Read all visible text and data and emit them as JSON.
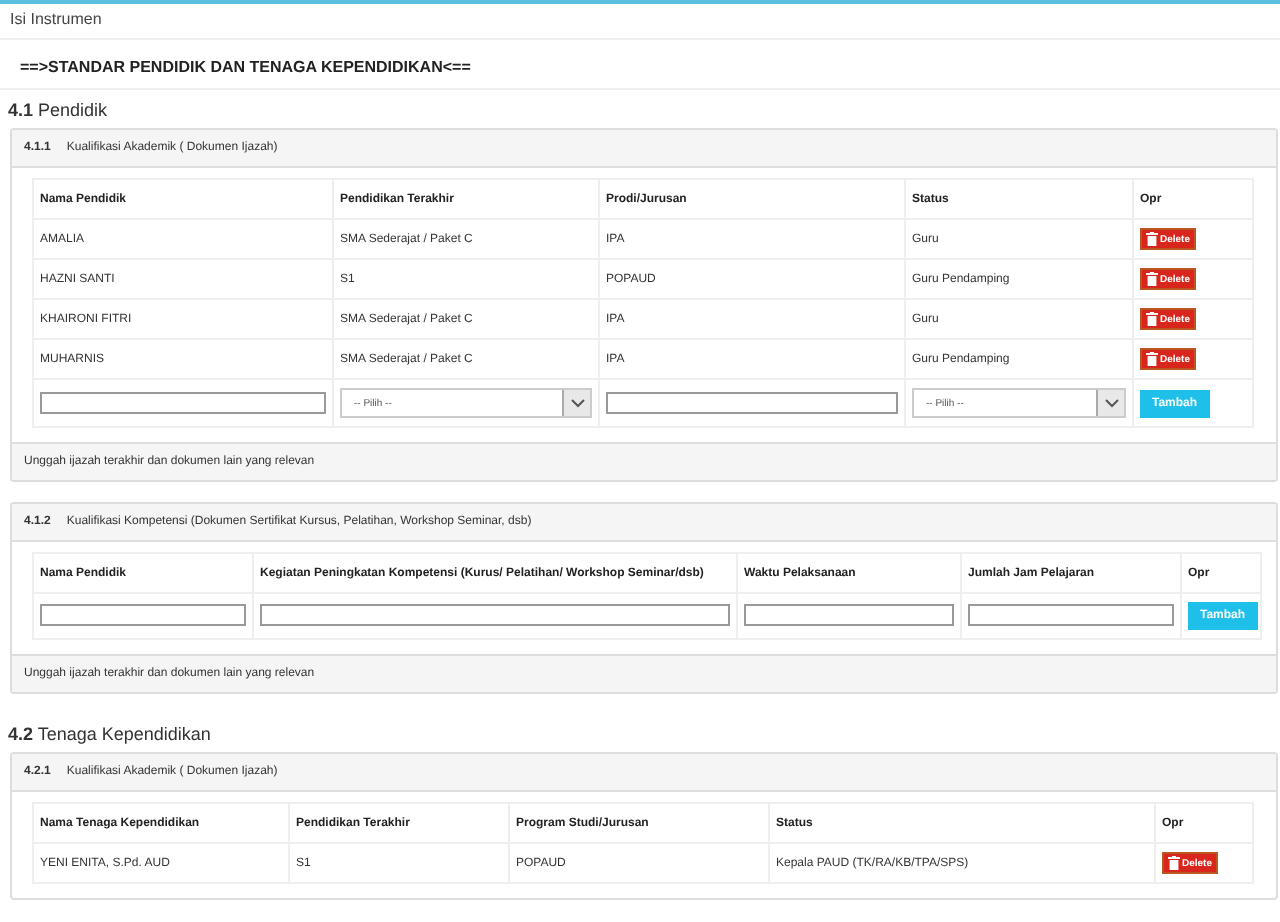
{
  "header": {
    "title": "Isi Instrumen"
  },
  "banner": "==>STANDAR PENDIDIK DAN TENAGA KEPENDIDIKAN<==",
  "sections": [
    {
      "number": "4.1",
      "title": "Pendidik",
      "panels": [
        {
          "number": "4.1.1",
          "title": "Kualifikasi Akademik ( Dokumen Ijazah)",
          "columns": [
            "Nama Pendidik",
            "Pendidikan Terakhir",
            "Prodi/Jurusan",
            "Status",
            "Opr"
          ],
          "rows": [
            {
              "cells": [
                "AMALIA",
                "SMA Sederajat / Paket C",
                "IPA",
                "Guru"
              ],
              "action": "Delete"
            },
            {
              "cells": [
                "HAZNI SANTI",
                "S1",
                "POPAUD",
                "Guru Pendamping"
              ],
              "action": "Delete"
            },
            {
              "cells": [
                "KHAIRONI FITRI",
                "SMA Sederajat / Paket C",
                "IPA",
                "Guru"
              ],
              "action": "Delete"
            },
            {
              "cells": [
                "MUHARNIS",
                "SMA Sederajat / Paket C",
                "IPA",
                "Guru Pendamping"
              ],
              "action": "Delete"
            }
          ],
          "inputs": [
            {
              "kind": "text"
            },
            {
              "kind": "select",
              "placeholder": "-- Pilih --"
            },
            {
              "kind": "text"
            },
            {
              "kind": "select",
              "placeholder": "-- Pilih --"
            }
          ],
          "button": "Tambah",
          "footer": "Unggah ijazah terakhir dan dokumen lain yang relevan"
        },
        {
          "number": "4.1.2",
          "title": "Kualifikasi Kompetensi (Dokumen Sertifikat Kursus, Pelatihan, Workshop Seminar, dsb)",
          "columns": [
            "Nama Pendidik",
            "Kegiatan Peningkatan Kompetensi (Kurus/ Pelatihan/ Workshop Seminar/dsb)",
            "Waktu Pelaksanaan",
            "Jumlah Jam Pelajaran",
            "Opr"
          ],
          "inputs": [
            {
              "kind": "text"
            },
            {
              "kind": "text"
            },
            {
              "kind": "text"
            },
            {
              "kind": "text"
            }
          ],
          "button": "Tambah",
          "footer": "Unggah ijazah terakhir dan dokumen lain yang relevan"
        }
      ]
    },
    {
      "number": "4.2",
      "title": "Tenaga Kependidikan",
      "panels": [
        {
          "number": "4.2.1",
          "title": "Kualifikasi Akademik ( Dokumen Ijazah)",
          "columns": [
            "Nama Tenaga Kependidikan",
            "Pendidikan Terakhir",
            "Program Studi/Jurusan",
            "Status",
            "Opr"
          ],
          "rows": [
            {
              "cells": [
                "YENI ENITA, S.Pd. AUD",
                "S1",
                "POPAUD",
                "Kepala PAUD (TK/RA/KB/TPA/SPS)"
              ],
              "action": "Delete"
            }
          ]
        }
      ]
    }
  ]
}
